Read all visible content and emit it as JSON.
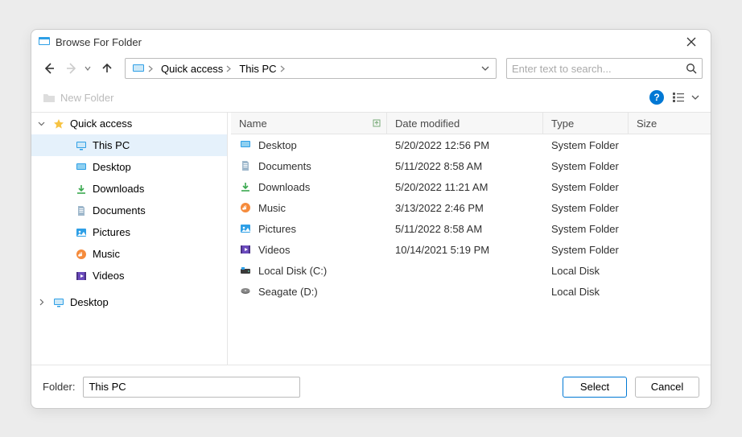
{
  "title": "Browse For Folder",
  "breadcrumbs": [
    {
      "label": "Quick access"
    },
    {
      "label": "This PC"
    }
  ],
  "search": {
    "placeholder": "Enter text to search..."
  },
  "toolbar": {
    "new_folder": "New Folder"
  },
  "tree": {
    "quick_access": {
      "label": "Quick access",
      "expanded": true
    },
    "children": [
      {
        "id": "this-pc",
        "label": "This PC",
        "icon": "monitor",
        "selected": true
      },
      {
        "id": "desktop",
        "label": "Desktop",
        "icon": "desktop"
      },
      {
        "id": "downloads",
        "label": "Downloads",
        "icon": "download"
      },
      {
        "id": "documents",
        "label": "Documents",
        "icon": "document"
      },
      {
        "id": "pictures",
        "label": "Pictures",
        "icon": "picture"
      },
      {
        "id": "music",
        "label": "Music",
        "icon": "music"
      },
      {
        "id": "videos",
        "label": "Videos",
        "icon": "video"
      }
    ],
    "desktop_root": {
      "label": "Desktop",
      "expanded": false
    }
  },
  "columns": {
    "name": "Name",
    "date": "Date modified",
    "type": "Type",
    "size": "Size"
  },
  "rows": [
    {
      "name": "Desktop",
      "icon": "desktop",
      "date": "5/20/2022 12:56 PM",
      "type": "System Folder"
    },
    {
      "name": "Documents",
      "icon": "document",
      "date": "5/11/2022 8:58 AM",
      "type": "System Folder"
    },
    {
      "name": "Downloads",
      "icon": "download",
      "date": "5/20/2022 11:21 AM",
      "type": "System Folder"
    },
    {
      "name": "Music",
      "icon": "music",
      "date": "3/13/2022 2:46 PM",
      "type": "System Folder"
    },
    {
      "name": "Pictures",
      "icon": "picture",
      "date": "5/11/2022 8:58 AM",
      "type": "System Folder"
    },
    {
      "name": "Videos",
      "icon": "video",
      "date": "10/14/2021 5:19 PM",
      "type": "System Folder"
    },
    {
      "name": "Local Disk (C:)",
      "icon": "disk",
      "date": "",
      "type": "Local Disk"
    },
    {
      "name": "Seagate (D:)",
      "icon": "disk2",
      "date": "",
      "type": "Local Disk"
    }
  ],
  "footer": {
    "label": "Folder:",
    "value": "This PC",
    "select": "Select",
    "cancel": "Cancel"
  }
}
